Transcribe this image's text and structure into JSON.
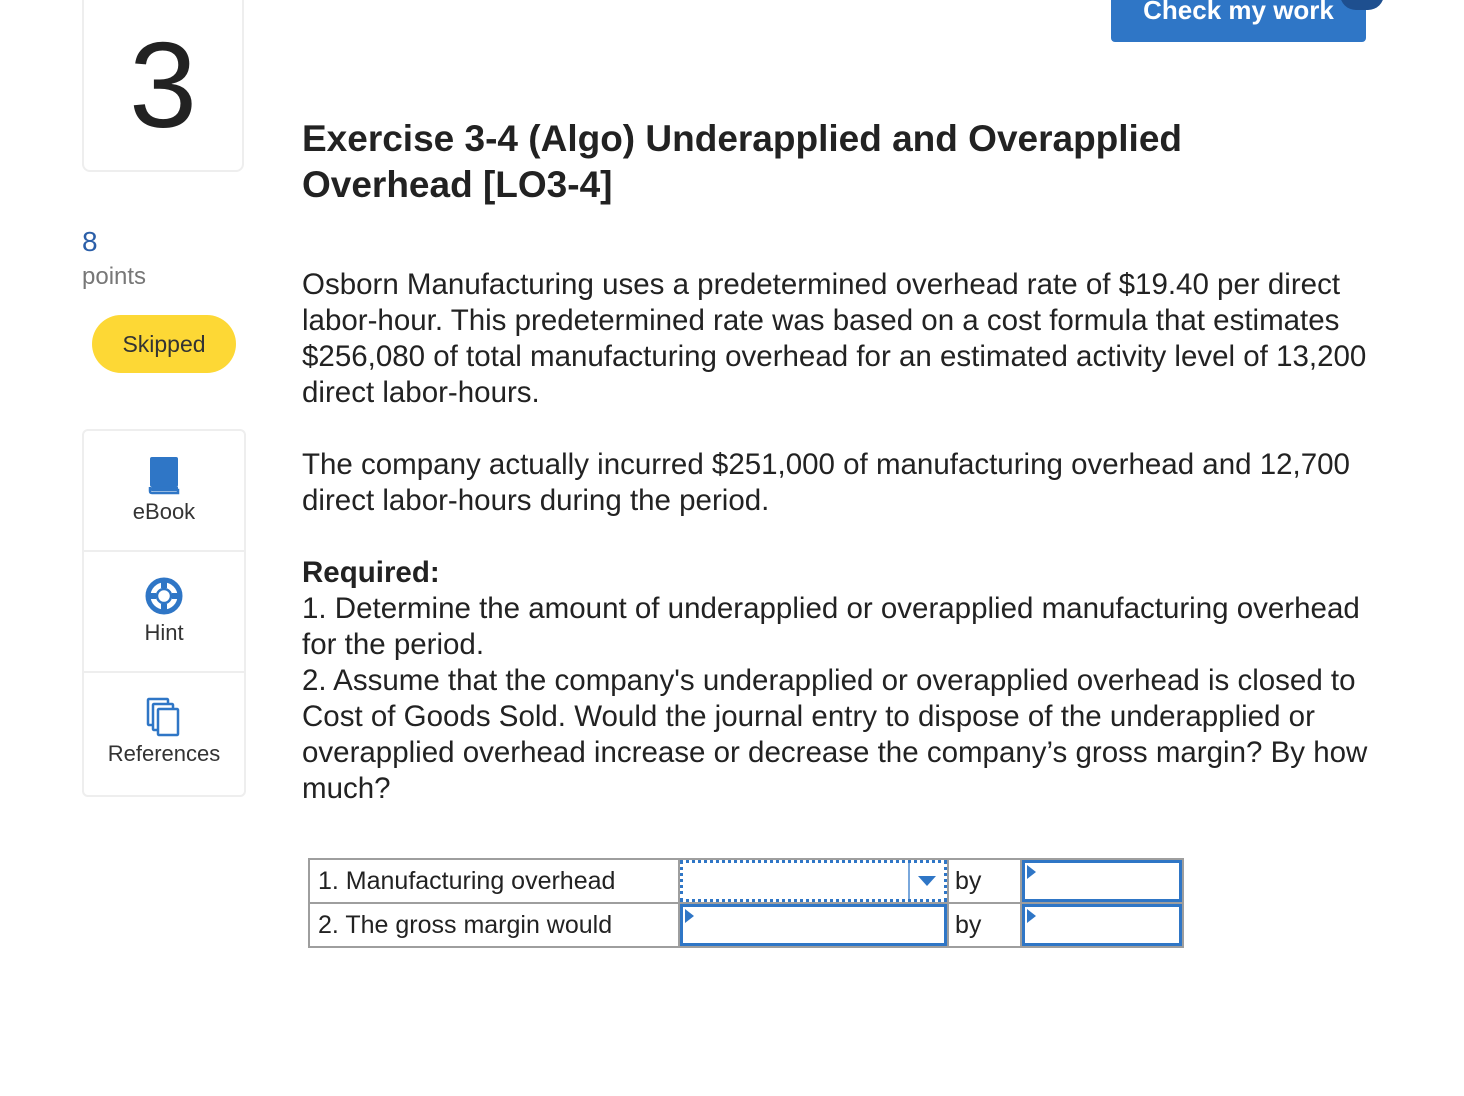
{
  "question": {
    "number": "3",
    "points": "8",
    "points_label": "points",
    "status": "Skipped"
  },
  "tools": [
    {
      "label": "eBook",
      "icon": "book-icon"
    },
    {
      "label": "Hint",
      "icon": "lifebuoy-icon"
    },
    {
      "label": "References",
      "icon": "copy-icon"
    }
  ],
  "header": {
    "check_button": "Check my work"
  },
  "exercise": {
    "title": "Exercise 3-4 (Algo) Underapplied and Overapplied Overhead [LO3-4]",
    "paragraph1": "Osborn Manufacturing uses a predetermined overhead rate of $19.40 per direct labor-hour. This predetermined rate was based on a cost formula that estimates $256,080 of total manufacturing overhead for an estimated activity level of 13,200 direct labor-hours.",
    "paragraph2": "The company actually incurred $251,000 of manufacturing overhead and 12,700 direct labor-hours during the period.",
    "required_heading": "Required:",
    "required1": "1. Determine the amount of underapplied or overapplied manufacturing overhead for the period.",
    "required2": "2. Assume that the company's underapplied or overapplied overhead is closed to Cost of Goods Sold. Would the journal entry to dispose of the underapplied or overapplied overhead increase or decrease the company’s gross margin? By how much?"
  },
  "answer_table": {
    "rows": [
      {
        "label": "1. Manufacturing overhead",
        "selection": "",
        "by": "by",
        "amount": ""
      },
      {
        "label": "2. The gross margin would",
        "selection": "",
        "by": "by",
        "amount": ""
      }
    ]
  },
  "colors": {
    "accent_blue": "#2f76c6",
    "badge_yellow": "#fdd835",
    "points_blue": "#2a5ea8"
  }
}
